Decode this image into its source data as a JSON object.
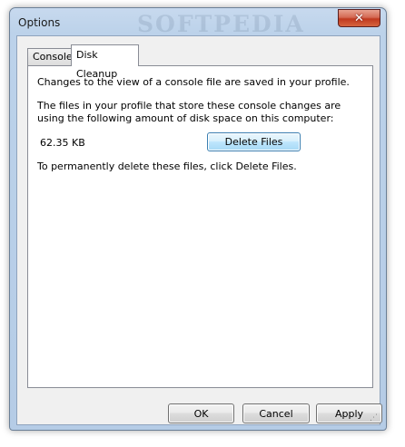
{
  "window": {
    "title": "Options",
    "watermark": "SOFTPEDIA"
  },
  "tabs": [
    {
      "label": "Console",
      "selected": false
    },
    {
      "label": "Disk Cleanup",
      "selected": true
    }
  ],
  "disk_cleanup": {
    "intro": "Changes to the view of a console file are saved in your profile.",
    "description": "The files in your profile that store these console changes are using the following amount of disk space on this computer:",
    "size": "62.35 KB",
    "delete_button": "Delete Files",
    "instruction": "To permanently delete these files, click Delete Files."
  },
  "buttons": {
    "ok": "OK",
    "cancel": "Cancel",
    "apply": "Apply"
  },
  "icons": {
    "close": "close-icon",
    "resize_grip": "resize-grip-icon"
  }
}
